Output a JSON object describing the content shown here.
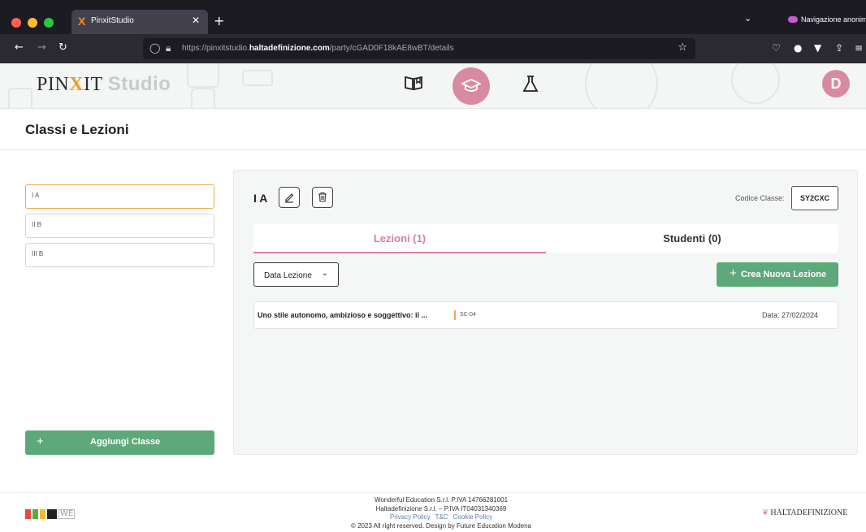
{
  "browser": {
    "tab_title": "PinxitStudio",
    "tab_favicon": "X",
    "private_label": "Navigazione anonim",
    "url_prefix": "https://pinxitstudio.",
    "url_domain": "haltadefinizione.com",
    "url_path": "/party/cGAD0F18kAE8wBT/details"
  },
  "header": {
    "logo_part1": "PIN",
    "logo_x": "X",
    "logo_part2": "IT",
    "logo_studio": "Studio",
    "avatar_initial": "D",
    "nav_icons": [
      "book-open-icon",
      "graduation-cap-icon",
      "flask-icon"
    ]
  },
  "page": {
    "title": "Classi e Lezioni"
  },
  "classes": {
    "items": [
      {
        "label": "I A",
        "active": true
      },
      {
        "label": "II B",
        "active": false
      },
      {
        "label": "III B",
        "active": false
      }
    ],
    "add_label": "Aggiungi Classe",
    "add_icon": "+"
  },
  "detail": {
    "class_name": "I A",
    "code_label": "Codice Classe:",
    "code_value": "SY2CXC",
    "tabs": [
      {
        "label": "Lezioni (1)",
        "active": true
      },
      {
        "label": "Studenti (0)",
        "active": false
      }
    ],
    "sort_label": "Data Lezione",
    "new_lesson_label": "Crea Nuova Lezione",
    "new_lesson_icon": "+",
    "lessons": [
      {
        "title": "Uno stile autonomo, ambizioso e soggettivo: il ...",
        "code": "SC-04",
        "date": "Data: 27/02/2024"
      }
    ]
  },
  "footer": {
    "line1": "Wonderful Education S.r.l. P.IVA 14766281001",
    "line2": "Haltadefinizione S.r.l. – P.IVA IT04031340369",
    "links": [
      "Privacy Policy",
      "T&C",
      "Cookie Policy"
    ],
    "line4": "© 2023 All right reserved. Design by Future Education Modena",
    "fem_we": "WE",
    "partner_logo": "HALTADEFINIZIONE"
  }
}
